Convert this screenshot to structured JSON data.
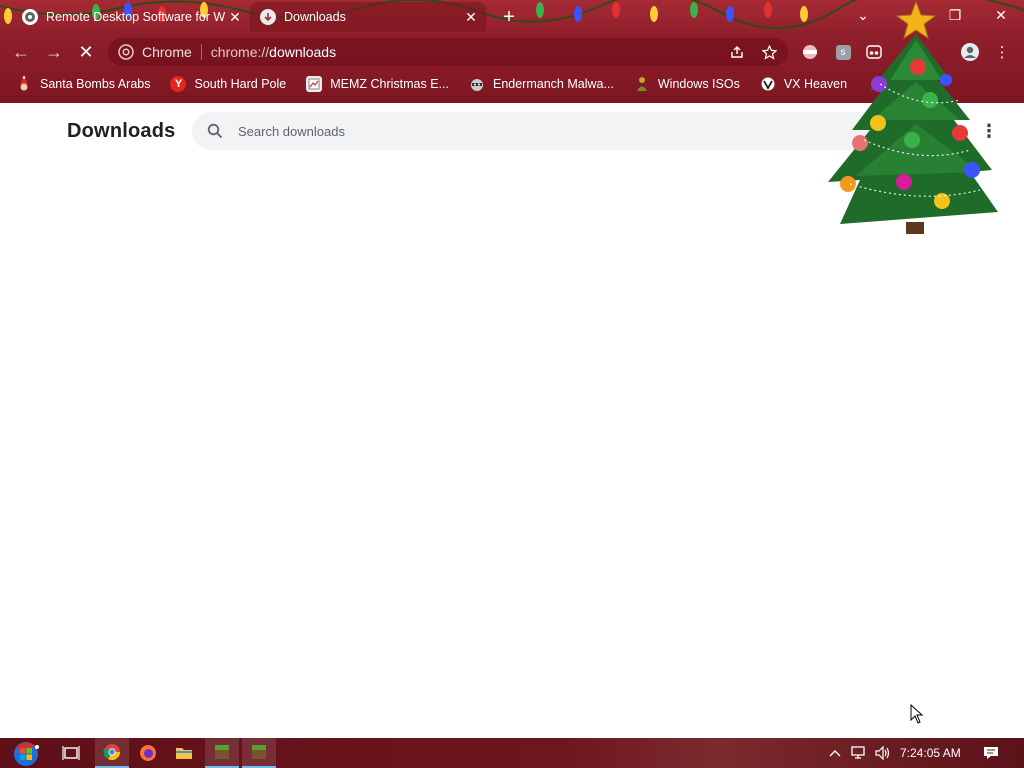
{
  "window": {
    "tabs": [
      {
        "title": "Remote Desktop Software for W",
        "active": false,
        "icon": "chrome-remote-desktop-icon"
      },
      {
        "title": "Downloads",
        "active": true,
        "icon": "download-icon"
      }
    ],
    "new_tab_label": "+",
    "controls": {
      "dropdown": "⌄",
      "restore": "❐",
      "close": "✕"
    }
  },
  "toolbar": {
    "site_label": "Chrome",
    "url_scheme": "chrome://",
    "url_path": "downloads"
  },
  "bookmarks": [
    {
      "label": "Santa Bombs Arabs",
      "icon": "santa-icon"
    },
    {
      "label": "South Hard Pole",
      "icon": "yandex-icon",
      "icon_text": "Y"
    },
    {
      "label": "MEMZ Christmas E...",
      "icon": "memz-icon"
    },
    {
      "label": "Endermanch Malwa...",
      "icon": "raccoon-icon"
    },
    {
      "label": "Windows ISOs",
      "icon": "figure-icon"
    },
    {
      "label": "VX Heaven",
      "icon": "vx-heaven-icon"
    }
  ],
  "page": {
    "title": "Downloads",
    "search_placeholder": "Search downloads"
  },
  "taskbar": {
    "clock": "7:24:05 AM"
  },
  "colors": {
    "chrome_red": "#8f1f2b",
    "page_bg": "#ffffff",
    "search_bg": "#f1f3f4",
    "taskbar": "#6e1620"
  }
}
